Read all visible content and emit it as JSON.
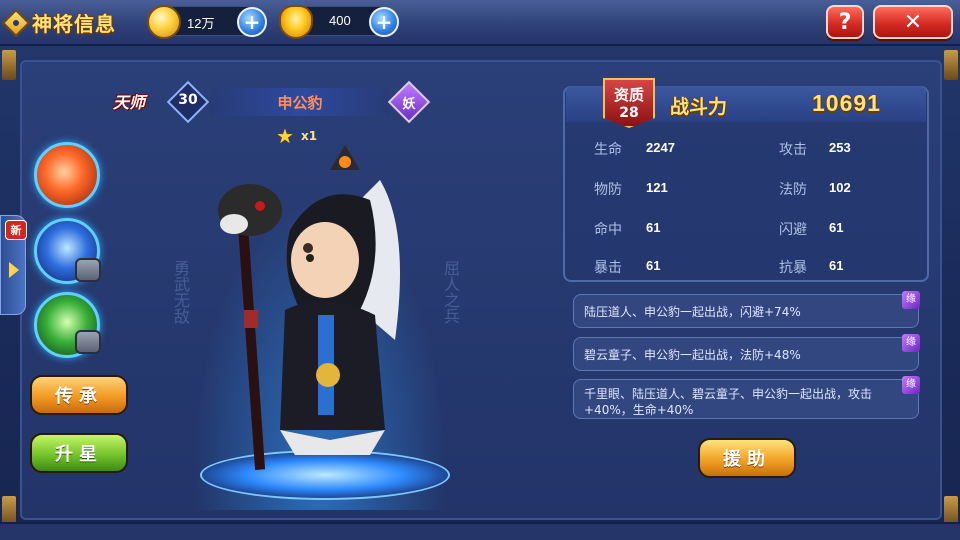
{
  "header": {
    "title": "神将信息",
    "currencies": [
      {
        "icon": "silver-coin-icon",
        "value": "12万"
      },
      {
        "icon": "gold-ingot-icon",
        "value": "400"
      }
    ],
    "help_label": "?",
    "close_label": "✕"
  },
  "sidebar": {
    "new_badge": "新",
    "buttons": {
      "inherit": "传承",
      "upstar": "升星"
    }
  },
  "hero": {
    "rank": "天师",
    "level": "30",
    "name": "申公豹",
    "faction": "妖",
    "stars": "x1",
    "calligraphy_left": "勇武无敌",
    "calligraphy_right": "屈人之兵"
  },
  "stats": {
    "aptitude_label": "资质",
    "aptitude_value": "28",
    "power_label": "战斗力",
    "power_value": "10691",
    "rows": [
      {
        "l1": "生命",
        "v1": "2247",
        "l2": "攻击",
        "v2": "253"
      },
      {
        "l1": "物防",
        "v1": "121",
        "l2": "法防",
        "v2": "102"
      },
      {
        "l1": "命中",
        "v1": "61",
        "l2": "闪避",
        "v2": "61"
      },
      {
        "l1": "暴击",
        "v1": "61",
        "l2": "抗暴",
        "v2": "61"
      }
    ]
  },
  "bonds": [
    {
      "text": "陆压道人、申公豹一起出战，闪避+74%",
      "tag": "缘"
    },
    {
      "text": "碧云童子、申公豹一起出战，法防+48%",
      "tag": "缘"
    },
    {
      "text": "千里眼、陆压道人、碧云童子、申公豹一起出战，攻击+40%，生命+40%",
      "tag": "缘"
    }
  ],
  "assist_label": "援助"
}
